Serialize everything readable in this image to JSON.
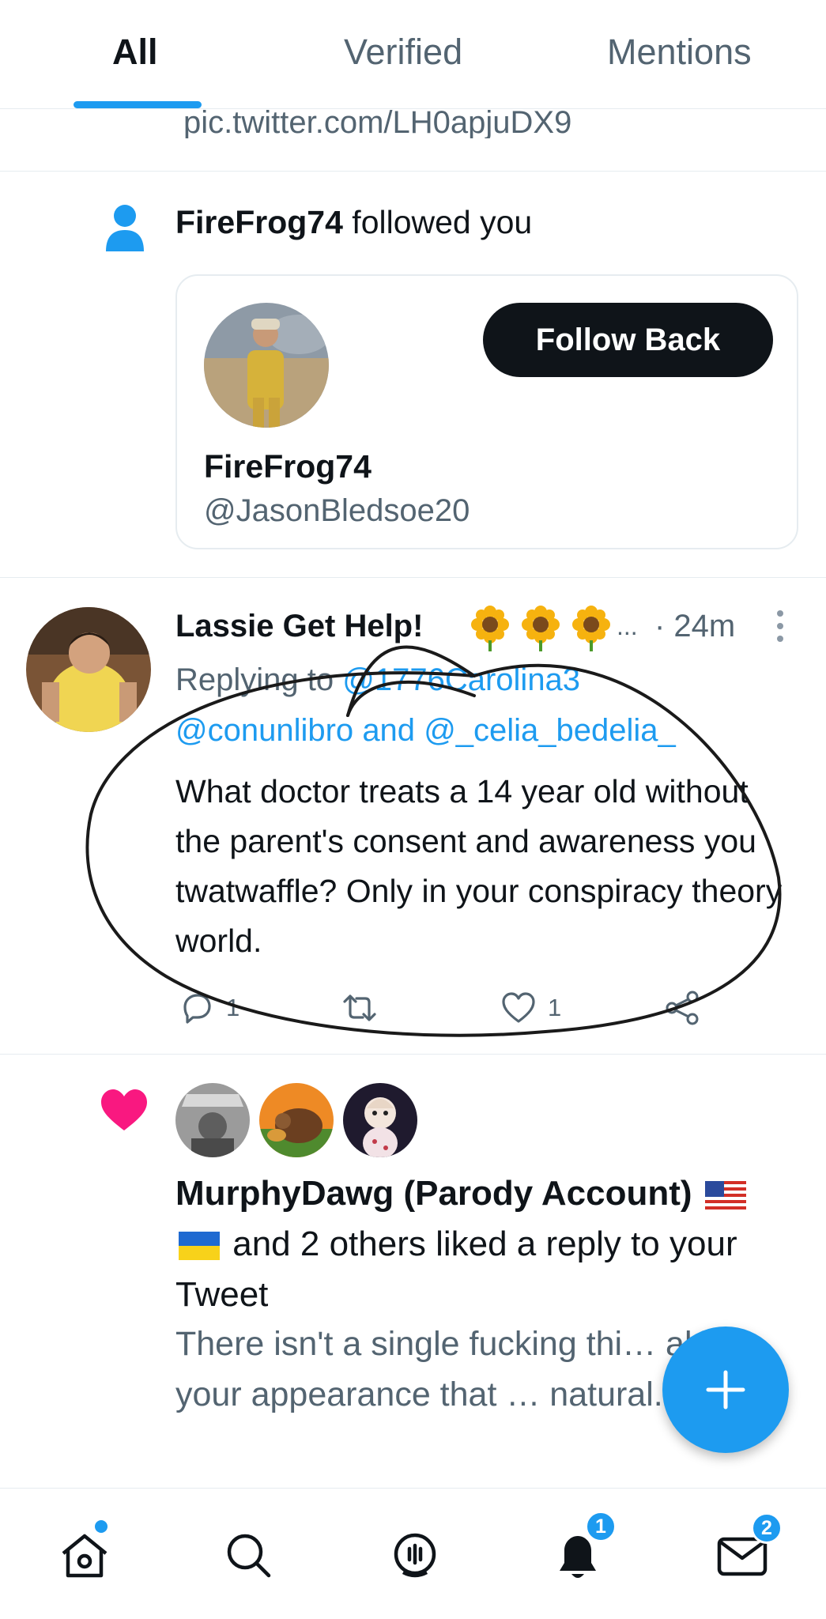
{
  "tabs": [
    {
      "label": "All",
      "active": true
    },
    {
      "label": "Verified",
      "active": false
    },
    {
      "label": "Mentions",
      "active": false
    }
  ],
  "clipped_link": "pic.twitter.com/LH0apjuDX9",
  "follow_notification": {
    "name": "FireFrog74",
    "action_text": "followed you",
    "card": {
      "follow_button": "Follow Back",
      "name": "FireFrog74",
      "handle": "@JasonBledsoe20"
    }
  },
  "reply_tweet": {
    "author": "Lassie Get Help!",
    "name_emoji": "sunflower",
    "truncation": "...",
    "time": "· 24m",
    "replying_prefix": "Replying to",
    "mention1": "@1776Carolina3",
    "mention2": "@conunlibro",
    "and_text": "and",
    "mention3": "@_celia_bedelia_",
    "text": "What doctor treats a 14 year old without the parent's consent and awareness you twatwaffle?  Only in your conspiracy theory world.",
    "reply_count": "1",
    "like_count": "1",
    "icons": [
      "reply-icon",
      "retweet-icon",
      "like-icon",
      "share-icon"
    ]
  },
  "like_notification": {
    "name": "MurphyDawg (Parody Account)",
    "rest_text": "and 2 others liked a reply to your Tweet",
    "quoted_text": "There isn't a single fucking thi… about your appearance that … natural."
  },
  "bottom_nav": {
    "items": [
      "home-icon",
      "search-icon",
      "spaces-icon",
      "notifications-icon",
      "messages-icon"
    ],
    "notifications_badge": "1",
    "messages_badge": "2"
  },
  "colors": {
    "accent": "#1d9bf0",
    "text_primary": "#0f1419",
    "text_secondary": "#536471",
    "like_pink": "#f91880",
    "annotation_ink": "#1a1a1a"
  }
}
